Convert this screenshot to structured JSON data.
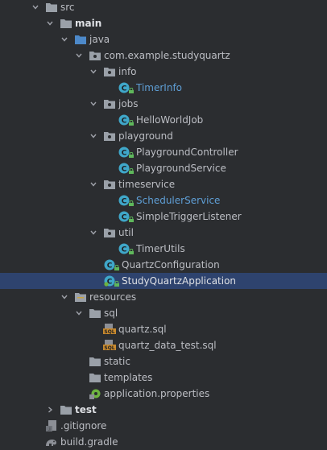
{
  "colors": {
    "background": "#2b2d30",
    "selection": "#2e436e",
    "text": "#bcbec4",
    "modified_text": "#5f9fd6",
    "folder": "#9aa0a8",
    "class_icon": "#3fa7c9",
    "lock": "#5fb85c"
  },
  "tree": {
    "src_label": "src",
    "main_label": "main",
    "java_label": "java",
    "package_label": "com.example.studyquartz",
    "info_label": "info",
    "timerinfo_label": "TimerInfo",
    "jobs_label": "jobs",
    "helloworldjob_label": "HelloWorldJob",
    "playground_label": "playground",
    "playgroundcontroller_label": "PlaygroundController",
    "playgroundservice_label": "PlaygroundService",
    "timeservice_label": "timeservice",
    "schedulerservice_label": "SchedulerService",
    "simpletriggerlistener_label": "SimpleTriggerListener",
    "util_label": "util",
    "timerutils_label": "TimerUtils",
    "quartzconfiguration_label": "QuartzConfiguration",
    "studyquartzapplication_label": "StudyQuartzApplication",
    "resources_label": "resources",
    "sql_label": "sql",
    "quartz_sql_label": "quartz.sql",
    "quartz_data_test_sql_label": "quartz_data_test.sql",
    "static_label": "static",
    "templates_label": "templates",
    "application_properties_label": "application.properties",
    "test_label": "test",
    "gitignore_label": ".gitignore",
    "build_gradle_label": "build.gradle"
  }
}
